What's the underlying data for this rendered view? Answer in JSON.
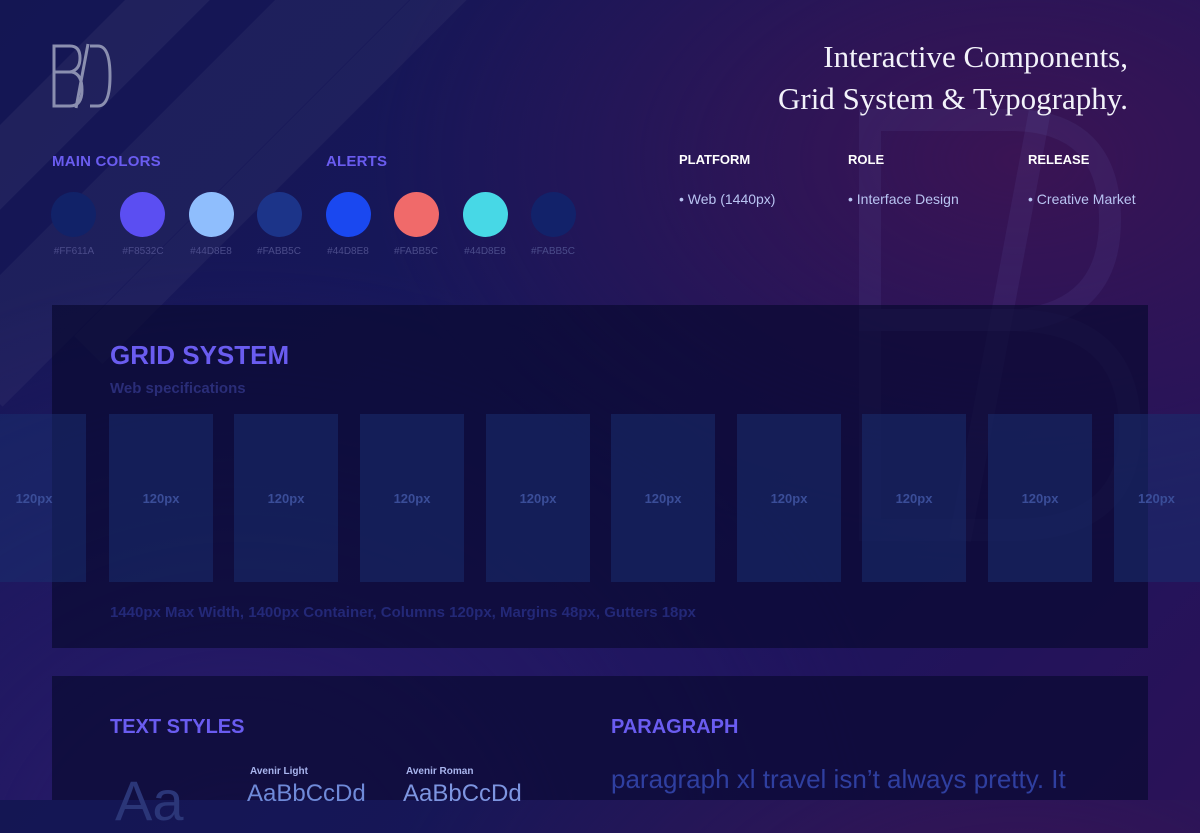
{
  "headline": {
    "line1": "Interactive Components,",
    "line2": "Grid System & Typography."
  },
  "colors": {
    "main_title": "MAIN COLORS",
    "alerts_title": "ALERTS",
    "main": [
      {
        "color": "#112268",
        "label": "#FF611A"
      },
      {
        "color": "#5b4ef2",
        "label": "#F8532C"
      },
      {
        "color": "#8fbefd",
        "label": "#44D8E8"
      },
      {
        "color": "#1c3489",
        "label": "#FABB5C"
      }
    ],
    "alerts": [
      {
        "color": "#1a48f0",
        "label": "#44D8E8"
      },
      {
        "color": "#f06a6a",
        "label": "#FABB5C"
      },
      {
        "color": "#47d8e6",
        "label": "#44D8E8"
      },
      {
        "color": "#12226a",
        "label": "#FABB5C"
      }
    ]
  },
  "meta": {
    "platform": {
      "label": "PLATFORM",
      "value": "• Web (1440px)"
    },
    "role": {
      "label": "ROLE",
      "value": "• Interface Design"
    },
    "release": {
      "label": "RELEASE",
      "value": "• Creative Market"
    }
  },
  "grid": {
    "title": "GRID SYSTEM",
    "subtitle": "Web specifications",
    "columns": [
      "120px",
      "120px",
      "120px",
      "120px",
      "120px",
      "120px",
      "120px",
      "120px",
      "120px",
      "120px"
    ],
    "spec": "1440px Max Width, 1400px Container, Columns 120px, Margins 48px, Gutters 18px"
  },
  "text_styles": {
    "title": "TEXT STYLES",
    "big_glyph": "Aa",
    "fonts": [
      {
        "name": "Avenir Light",
        "sample": "AaBbCcDd"
      },
      {
        "name": "Avenir Roman",
        "sample": "AaBbCcDd"
      }
    ]
  },
  "paragraph": {
    "title": "PARAGRAPH",
    "text": "paragraph xl travel isn’t always pretty. It"
  }
}
